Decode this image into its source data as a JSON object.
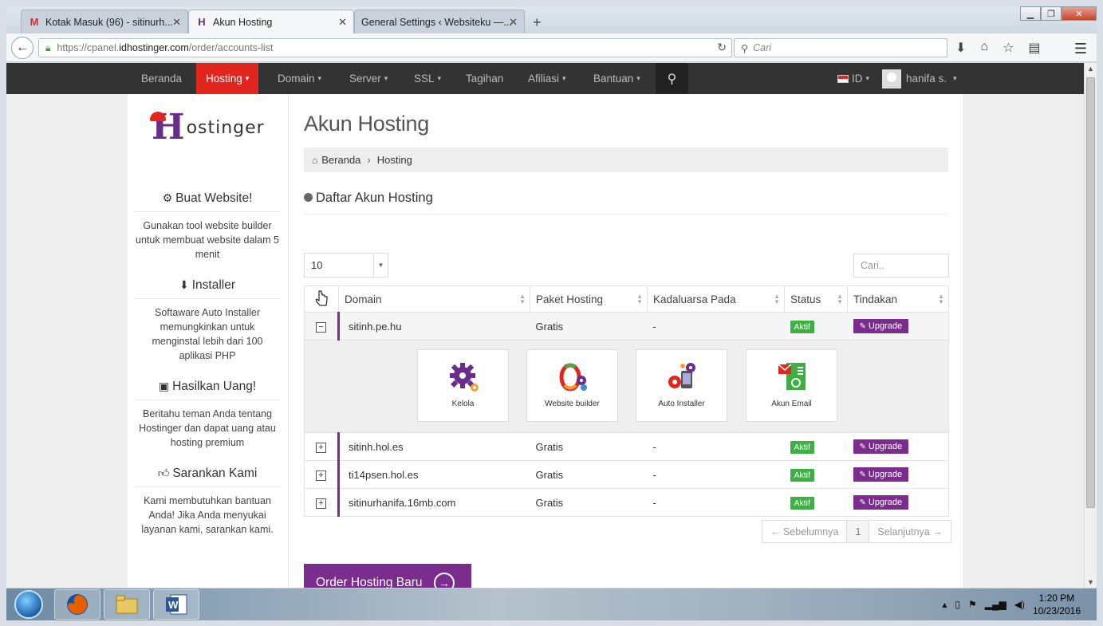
{
  "browser": {
    "tabs": [
      {
        "label": "Kotak Masuk (96) - sitinurh...",
        "favicon": "M",
        "active": false
      },
      {
        "label": "Akun Hosting",
        "favicon": "H",
        "active": true
      },
      {
        "label": "General Settings ‹ Websiteku —...",
        "favicon": "",
        "active": false
      }
    ],
    "url_prefix": "https://cpanel.",
    "url_domain": "idhostinger.com",
    "url_path": "/order/accounts-list",
    "search_placeholder": "Cari"
  },
  "sitenav": {
    "items": [
      "Beranda",
      "Hosting",
      "Domain",
      "Server",
      "SSL",
      "Tagihan",
      "Afiliasi",
      "Bantuan"
    ],
    "lang": "ID",
    "user": "hanifa s."
  },
  "sidebar": {
    "logo_rest": "ostinger",
    "blocks": [
      {
        "title": "Buat Website!",
        "icon": "gears-icon",
        "text": "Gunakan tool website builder untuk membuat website dalam 5 menit"
      },
      {
        "title": "Installer",
        "icon": "download-icon",
        "text": "Softaware Auto Installer memungkinkan untuk menginstal lebih dari 100 aplikasi PHP"
      },
      {
        "title": "Hasilkan Uang!",
        "icon": "money-icon",
        "text": "Beritahu teman Anda tentang Hostinger dan dapat uang atau hosting premium"
      },
      {
        "title": "Sarankan Kami",
        "icon": "thumbs-up-icon",
        "text": "Kami membutuhkan bantuan Anda! Jika Anda menyukai layanan kami, sarankan kami."
      }
    ]
  },
  "main": {
    "title": "Akun Hosting",
    "breadcrumb": [
      "Beranda",
      "Hosting"
    ],
    "section_title": "Daftar Akun Hosting",
    "page_size": "10",
    "search_placeholder": "Cari..",
    "columns": [
      "Domain",
      "Paket Hosting",
      "Kadaluarsa Pada",
      "Status",
      "Tindakan"
    ],
    "rows": [
      {
        "domain": "sitinh.pe.hu",
        "plan": "Gratis",
        "expires": "-",
        "status": "Aktif",
        "action": "Upgrade"
      },
      {
        "domain": "sitinh.hol.es",
        "plan": "Gratis",
        "expires": "-",
        "status": "Aktif",
        "action": "Upgrade"
      },
      {
        "domain": "ti14psen.hol.es",
        "plan": "Gratis",
        "expires": "-",
        "status": "Aktif",
        "action": "Upgrade"
      },
      {
        "domain": "sitinurhanifa.16mb.com",
        "plan": "Gratis",
        "expires": "-",
        "status": "Aktif",
        "action": "Upgrade"
      }
    ],
    "tiles": [
      "Kelola",
      "Website builder",
      "Auto Installer",
      "Akun Email"
    ],
    "pager": {
      "prev": "← Sebelumnya",
      "page": "1",
      "next": "Selanjutnya →"
    },
    "order_button": "Order Hosting Baru"
  },
  "taskbar": {
    "time": "1:20 PM",
    "date": "10/23/2016"
  },
  "colors": {
    "accent_red": "#e2261d",
    "purple": "#7b2d8e",
    "green": "#3cb043",
    "nav_dark": "#333333"
  }
}
